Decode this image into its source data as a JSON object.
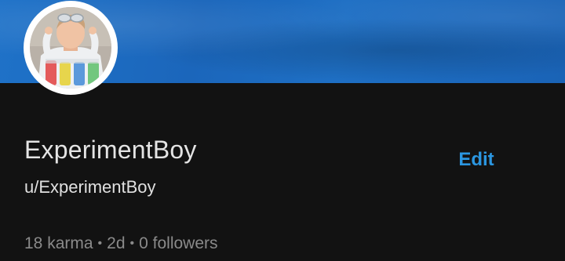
{
  "profile": {
    "display_name": "ExperimentBoy",
    "username": "u/ExperimentBoy",
    "edit_label": "Edit",
    "karma": "18 karma",
    "age": "2d",
    "followers": "0 followers",
    "separator": "•"
  },
  "colors": {
    "banner": "#1e6dc3",
    "background": "#121212",
    "accent": "#2b96e0",
    "muted": "#8a8a8a"
  },
  "icons": {
    "avatar": "profile-photo"
  }
}
